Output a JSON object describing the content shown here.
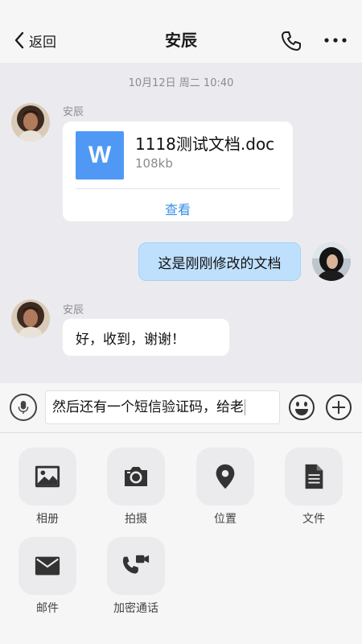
{
  "header": {
    "back_label": "返回",
    "title": "安辰"
  },
  "chat": {
    "timestamp": "10月12日 周二 10:40",
    "messages": [
      {
        "sender": "安辰",
        "type": "file",
        "file_type_letter": "W",
        "file_name": "1118测试文档.doc",
        "file_size": "108kb",
        "action_label": "查看"
      },
      {
        "sender": "me",
        "type": "text",
        "text": "这是刚刚修改的文档"
      },
      {
        "sender": "安辰",
        "type": "text",
        "text": "好，收到，谢谢！"
      }
    ]
  },
  "input": {
    "value": "然后还有一个短信验证码，给老"
  },
  "tools": [
    {
      "label": "相册",
      "icon": "photo-album-icon"
    },
    {
      "label": "拍摄",
      "icon": "camera-icon"
    },
    {
      "label": "位置",
      "icon": "location-pin-icon"
    },
    {
      "label": "文件",
      "icon": "document-icon"
    },
    {
      "label": "邮件",
      "icon": "mail-icon"
    },
    {
      "label": "加密通话",
      "icon": "video-call-icon"
    }
  ],
  "colors": {
    "accent": "#3a8ee6",
    "file_icon": "#4f99f4",
    "outgoing_bubble": "#bfe0fd",
    "background": "#ebebef"
  }
}
